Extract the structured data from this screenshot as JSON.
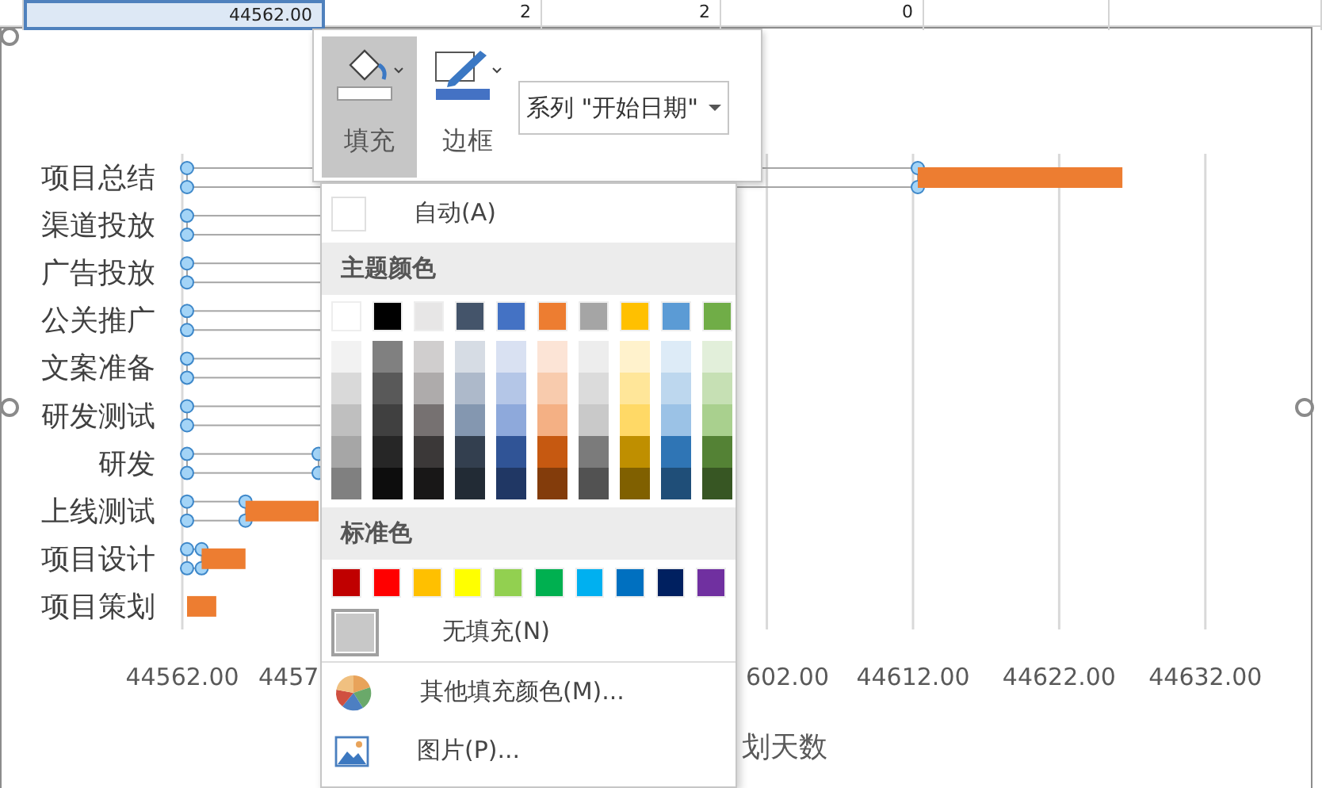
{
  "sheet_row": {
    "cells": [
      {
        "text": "44562.00",
        "selected": true
      },
      {
        "text": "2",
        "selected": false
      },
      {
        "text": "2",
        "selected": false
      },
      {
        "text": "0",
        "selected": false
      }
    ]
  },
  "chart": {
    "categories": [
      "项目总结",
      "渠道投放",
      "广告投放",
      "公关推广",
      "文案准备",
      "研发测试",
      "研发",
      "上线测试",
      "项目设计",
      "项目策划"
    ],
    "tick_labels": [
      "44562.00",
      "4457",
      "602.00",
      "44612.00",
      "44622.00",
      "44632.00"
    ],
    "axis_title": "划天数"
  },
  "toolbar": {
    "buttons": [
      {
        "kind": "fill",
        "label": "填充",
        "selected": true
      },
      {
        "kind": "border",
        "label": "边框",
        "selected": false
      }
    ],
    "series_selector": {
      "value": "系列 \"开始日期\""
    }
  },
  "fill_menu": {
    "automatic": {
      "label": "自动(A)",
      "color": "#ffffff"
    },
    "theme_header": "主题颜色",
    "theme_colors": [
      {
        "color": "#ffffff",
        "shades": [
          {
            "color": "#f2f2f2"
          },
          {
            "color": "#d9d9d9"
          },
          {
            "color": "#bfbfbf"
          },
          {
            "color": "#a6a6a6"
          },
          {
            "color": "#808080"
          }
        ]
      },
      {
        "color": "#000000",
        "shades": [
          {
            "color": "#808080"
          },
          {
            "color": "#595959"
          },
          {
            "color": "#404040"
          },
          {
            "color": "#262626"
          },
          {
            "color": "#0d0d0d"
          }
        ]
      },
      {
        "color": "#e7e6e6",
        "shades": [
          {
            "color": "#d0cece"
          },
          {
            "color": "#aeabab"
          },
          {
            "color": "#767171"
          },
          {
            "color": "#3b3838"
          },
          {
            "color": "#181717"
          }
        ]
      },
      {
        "color": "#44546a",
        "shades": [
          {
            "color": "#d6dce4"
          },
          {
            "color": "#adb9ca"
          },
          {
            "color": "#8497b0"
          },
          {
            "color": "#333f4f"
          },
          {
            "color": "#222b35"
          }
        ]
      },
      {
        "color": "#4472c4",
        "shades": [
          {
            "color": "#d9e1f2"
          },
          {
            "color": "#b4c6e7"
          },
          {
            "color": "#8ea9db"
          },
          {
            "color": "#305496"
          },
          {
            "color": "#203764"
          }
        ]
      },
      {
        "color": "#ed7d31",
        "shades": [
          {
            "color": "#fce4d6"
          },
          {
            "color": "#f8cbad"
          },
          {
            "color": "#f4b084"
          },
          {
            "color": "#c65911"
          },
          {
            "color": "#833c0b"
          }
        ]
      },
      {
        "color": "#a5a5a5",
        "shades": [
          {
            "color": "#ededed"
          },
          {
            "color": "#dbdbdb"
          },
          {
            "color": "#c9c9c9"
          },
          {
            "color": "#7b7b7b"
          },
          {
            "color": "#525252"
          }
        ]
      },
      {
        "color": "#ffc000",
        "shades": [
          {
            "color": "#fff2cc"
          },
          {
            "color": "#ffe699"
          },
          {
            "color": "#ffd966"
          },
          {
            "color": "#bf8f00"
          },
          {
            "color": "#806000"
          }
        ]
      },
      {
        "color": "#5b9bd5",
        "shades": [
          {
            "color": "#ddebf7"
          },
          {
            "color": "#bdd7ee"
          },
          {
            "color": "#9bc2e6"
          },
          {
            "color": "#2f75b5"
          },
          {
            "color": "#1f4e78"
          }
        ]
      },
      {
        "color": "#70ad47",
        "shades": [
          {
            "color": "#e2efda"
          },
          {
            "color": "#c6e0b4"
          },
          {
            "color": "#a9d08e"
          },
          {
            "color": "#548235"
          },
          {
            "color": "#375623"
          }
        ]
      }
    ],
    "standard_header": "标准色",
    "standard_colors": [
      {
        "color": "#c00000"
      },
      {
        "color": "#ff0000"
      },
      {
        "color": "#ffc000"
      },
      {
        "color": "#ffff00"
      },
      {
        "color": "#92d050"
      },
      {
        "color": "#00b050"
      },
      {
        "color": "#00b0f0"
      },
      {
        "color": "#0070c0"
      },
      {
        "color": "#002060"
      },
      {
        "color": "#7030a0"
      }
    ],
    "no_fill": {
      "label": "无填充(N)",
      "selected": true
    },
    "items": [
      {
        "kind": "more_colors",
        "label": "其他填充颜色(M)..."
      },
      {
        "kind": "picture",
        "label": "图片(P)..."
      }
    ]
  }
}
